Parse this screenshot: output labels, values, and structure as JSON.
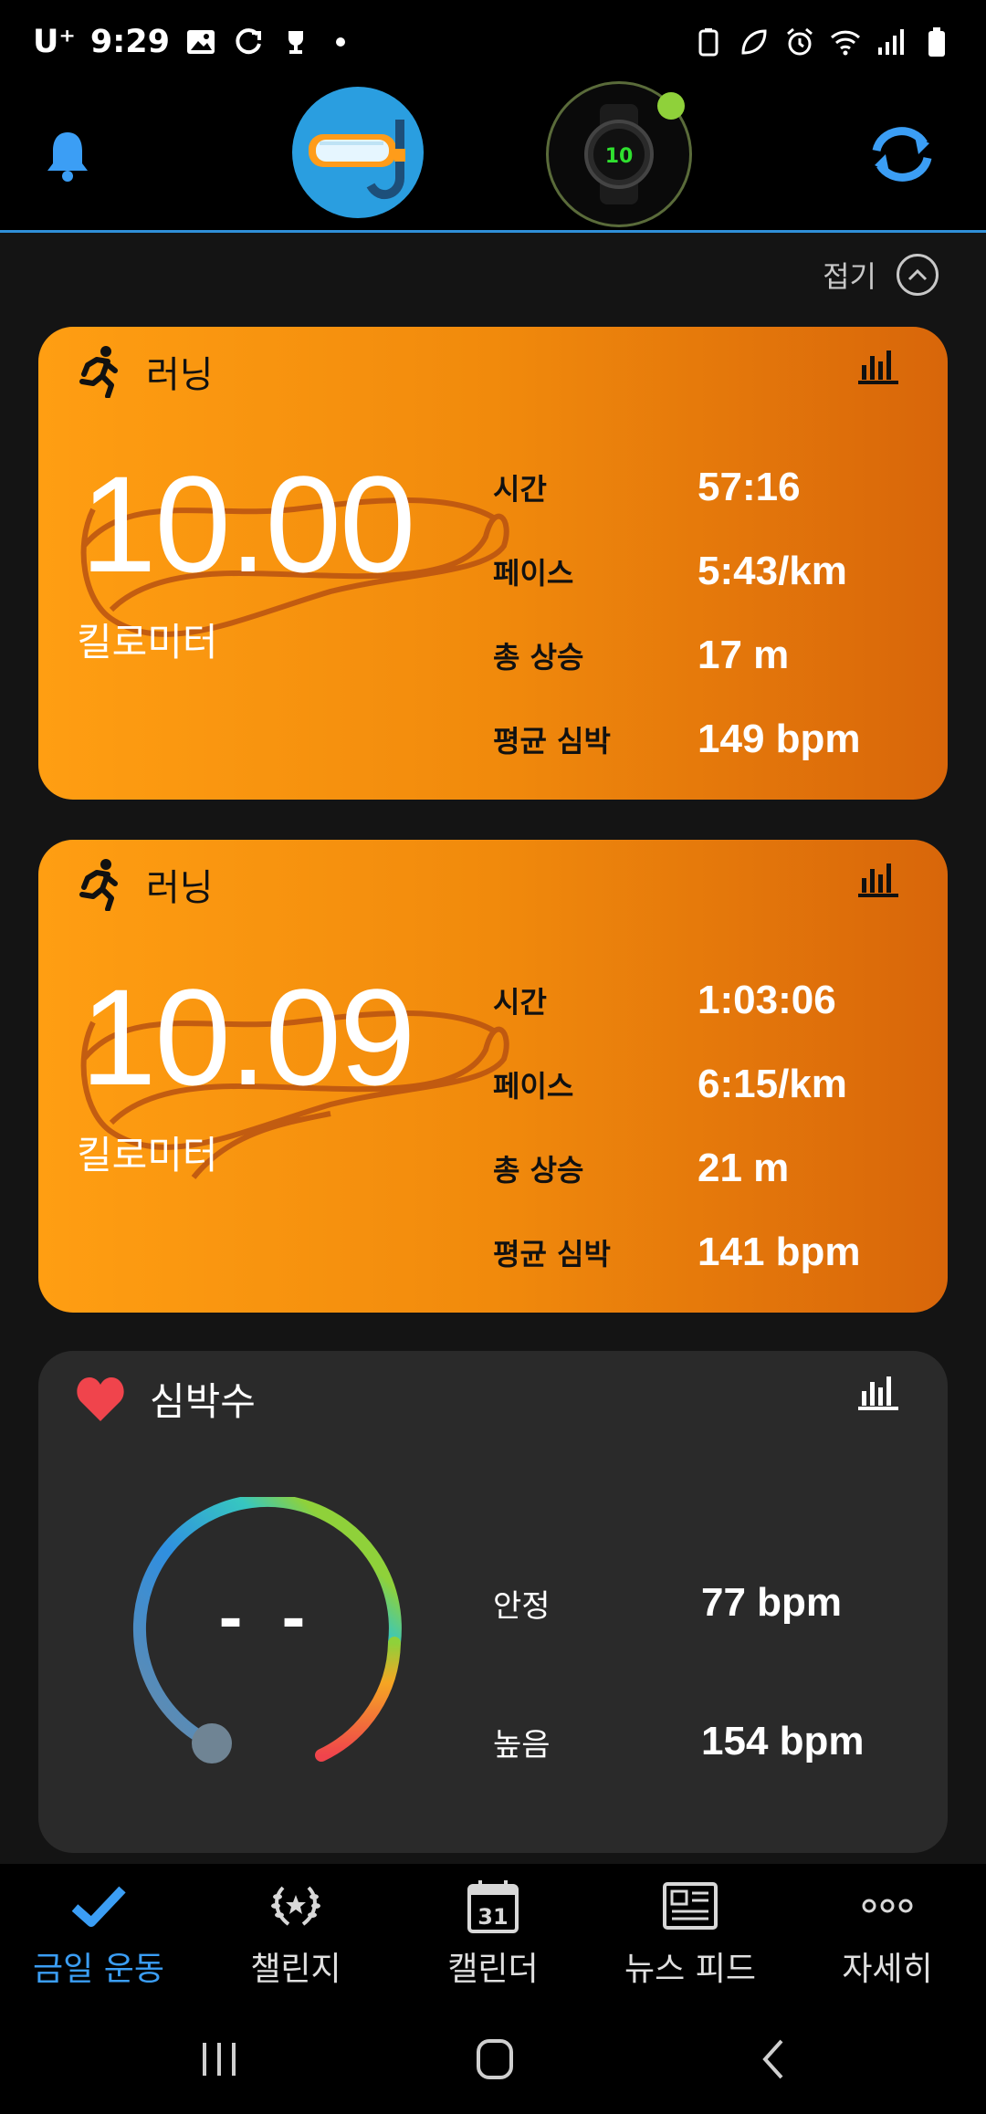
{
  "status_bar": {
    "carrier": "U⁺",
    "time": "9:29"
  },
  "collapse": {
    "label": "접기"
  },
  "activities": [
    {
      "type": "러닝",
      "distance": "10.00",
      "unit": "킬로미터",
      "stats": [
        {
          "label": "시간",
          "value": "57:16"
        },
        {
          "label": "페이스",
          "value": "5:43/km"
        },
        {
          "label": "총 상승",
          "value": "17 m"
        },
        {
          "label": "평균 심박",
          "value": "149 bpm"
        }
      ]
    },
    {
      "type": "러닝",
      "distance": "10.09",
      "unit": "킬로미터",
      "stats": [
        {
          "label": "시간",
          "value": "1:03:06"
        },
        {
          "label": "페이스",
          "value": "6:15/km"
        },
        {
          "label": "총 상승",
          "value": "21 m"
        },
        {
          "label": "평균 심박",
          "value": "141 bpm"
        }
      ]
    }
  ],
  "heart_rate": {
    "title": "심박수",
    "current": "- -",
    "stats": [
      {
        "label": "안정",
        "value": "77 bpm"
      },
      {
        "label": "높음",
        "value": "154 bpm"
      }
    ]
  },
  "bottom_nav": {
    "items": [
      {
        "label": "금일 운동",
        "icon": "check-icon",
        "active": true
      },
      {
        "label": "챌린지",
        "icon": "laurel-icon",
        "active": false
      },
      {
        "label": "캘린더",
        "icon": "calendar-icon",
        "active": false,
        "calendar_day": "31"
      },
      {
        "label": "뉴스 피드",
        "icon": "newspaper-icon",
        "active": false
      },
      {
        "label": "자세히",
        "icon": "more-icon",
        "active": false
      }
    ]
  },
  "colors": {
    "accent": "#3b9ef5",
    "card_orange_start": "#ff9e12",
    "card_orange_end": "#d8660a",
    "heart": "#f0444c"
  }
}
